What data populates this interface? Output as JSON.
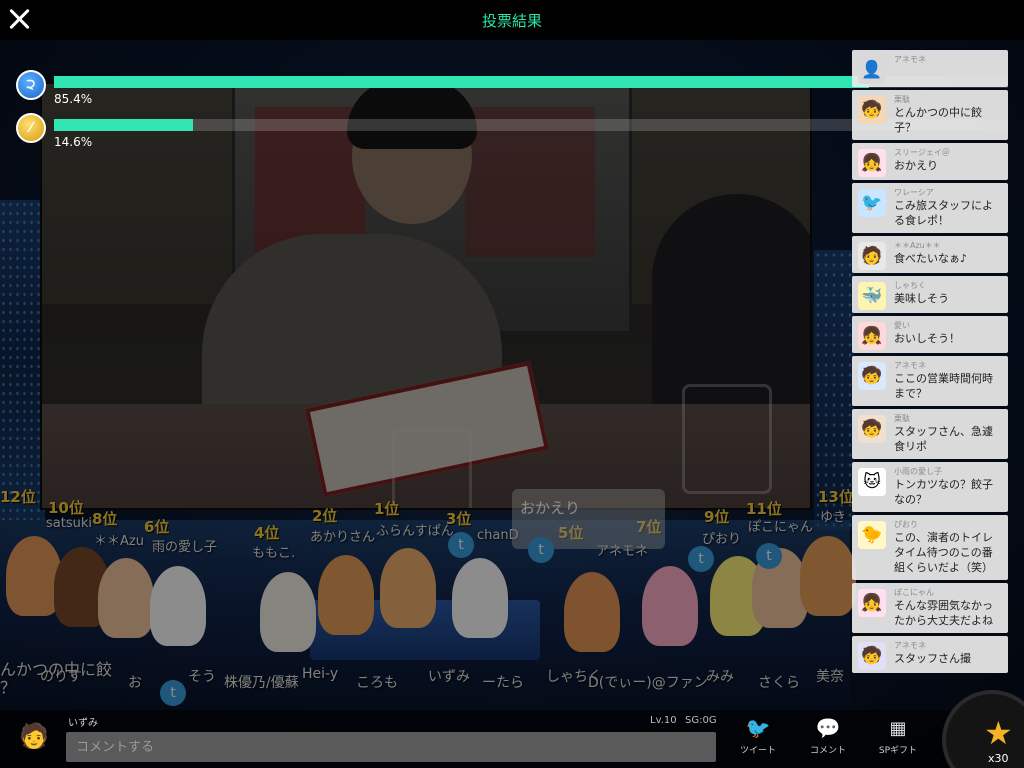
{
  "header": {
    "title": "投票結果"
  },
  "vote": {
    "options": [
      {
        "icon": "blue-coin-icon",
        "percent_label": "85.4%",
        "fraction": 0.854,
        "color": "#1e66c8"
      },
      {
        "icon": "gold-coin-icon",
        "percent_label": "14.6%",
        "fraction": 0.146,
        "color": "#d69a10"
      }
    ],
    "bar_color": "#32e6b4"
  },
  "comments": [
    {
      "name": "アネモネ",
      "text": "",
      "avatar": "👤"
    },
    {
      "name": "栗駄",
      "text": "とんかつの中に餃子？",
      "avatar": "🧒"
    },
    {
      "name": "スリージェイ＠",
      "text": "おかえり",
      "avatar": "👧"
    },
    {
      "name": "ワレーシア",
      "text": "こみ旅スタッフによる食レポ！",
      "avatar": "🐦"
    },
    {
      "name": "＊＊Azu＊＊",
      "text": "食べたいなぁ♪",
      "avatar": "🧑"
    },
    {
      "name": "しゃちく",
      "text": "美味しそう",
      "avatar": "🐳"
    },
    {
      "name": "愛い",
      "text": "おいしそう！",
      "avatar": "👧"
    },
    {
      "name": "アネモネ",
      "text": "ここの営業時間何時まで？",
      "avatar": "🧒"
    },
    {
      "name": "栗駄",
      "text": "スタッフさん、急遽食リポ",
      "avatar": "🧒"
    },
    {
      "name": "小雨の愛し子",
      "text": "トンカツなの？餃子なの？",
      "avatar": "🐱"
    },
    {
      "name": "ぴおり",
      "text": "この、演者のトイレタイム待つのこの番組くらいだよ（笑）",
      "avatar": "🐤"
    },
    {
      "name": "ぽこにゃん",
      "text": "そんな雰囲気なかったから大丈夫だよね",
      "avatar": "👧"
    },
    {
      "name": "アネモネ",
      "text": "スタッフさん撮",
      "avatar": "🧒"
    }
  ],
  "fans": {
    "ranks": [
      {
        "rank": "12位",
        "name": ""
      },
      {
        "rank": "10位",
        "name": "satsuki"
      },
      {
        "rank": "8位",
        "name": "＊＊Azu"
      },
      {
        "rank": "6位",
        "name": "雨の愛し子"
      },
      {
        "rank": "4位",
        "name": "ももこ."
      },
      {
        "rank": "2位",
        "name": "あかりさん"
      },
      {
        "rank": "1位",
        "name": "ふらんすぱん"
      },
      {
        "rank": "3位",
        "name": "chanD"
      },
      {
        "rank": "5位",
        "name": "アネモネ"
      },
      {
        "rank": "7位",
        "name": ""
      },
      {
        "rank": "9位",
        "name": "ぴおり"
      },
      {
        "rank": "11位",
        "name": "ぽこにゃん"
      },
      {
        "rank": "13位",
        "name": "ゆき"
      }
    ],
    "bubble_text": "おかえり",
    "left_partial": "んかつの中に餃",
    "left_partial2": "？",
    "bottom_names": [
      "のりす",
      "お",
      "そう",
      "株優乃/優蘇",
      "Hei-y",
      "ころも",
      "いずみ",
      "ーたら",
      "しゃちく",
      "D(でぃー)@ファン",
      "みみ",
      "さくら",
      "美奈"
    ]
  },
  "bottom": {
    "username": "いずみ",
    "input_placeholder": "コメントする",
    "level": "Lv.10",
    "sg": "SG:0G",
    "tweet_label": "ツイート",
    "comment_label": "コメント",
    "sp_gift_label": "SPギフト",
    "star_count": "x30"
  }
}
